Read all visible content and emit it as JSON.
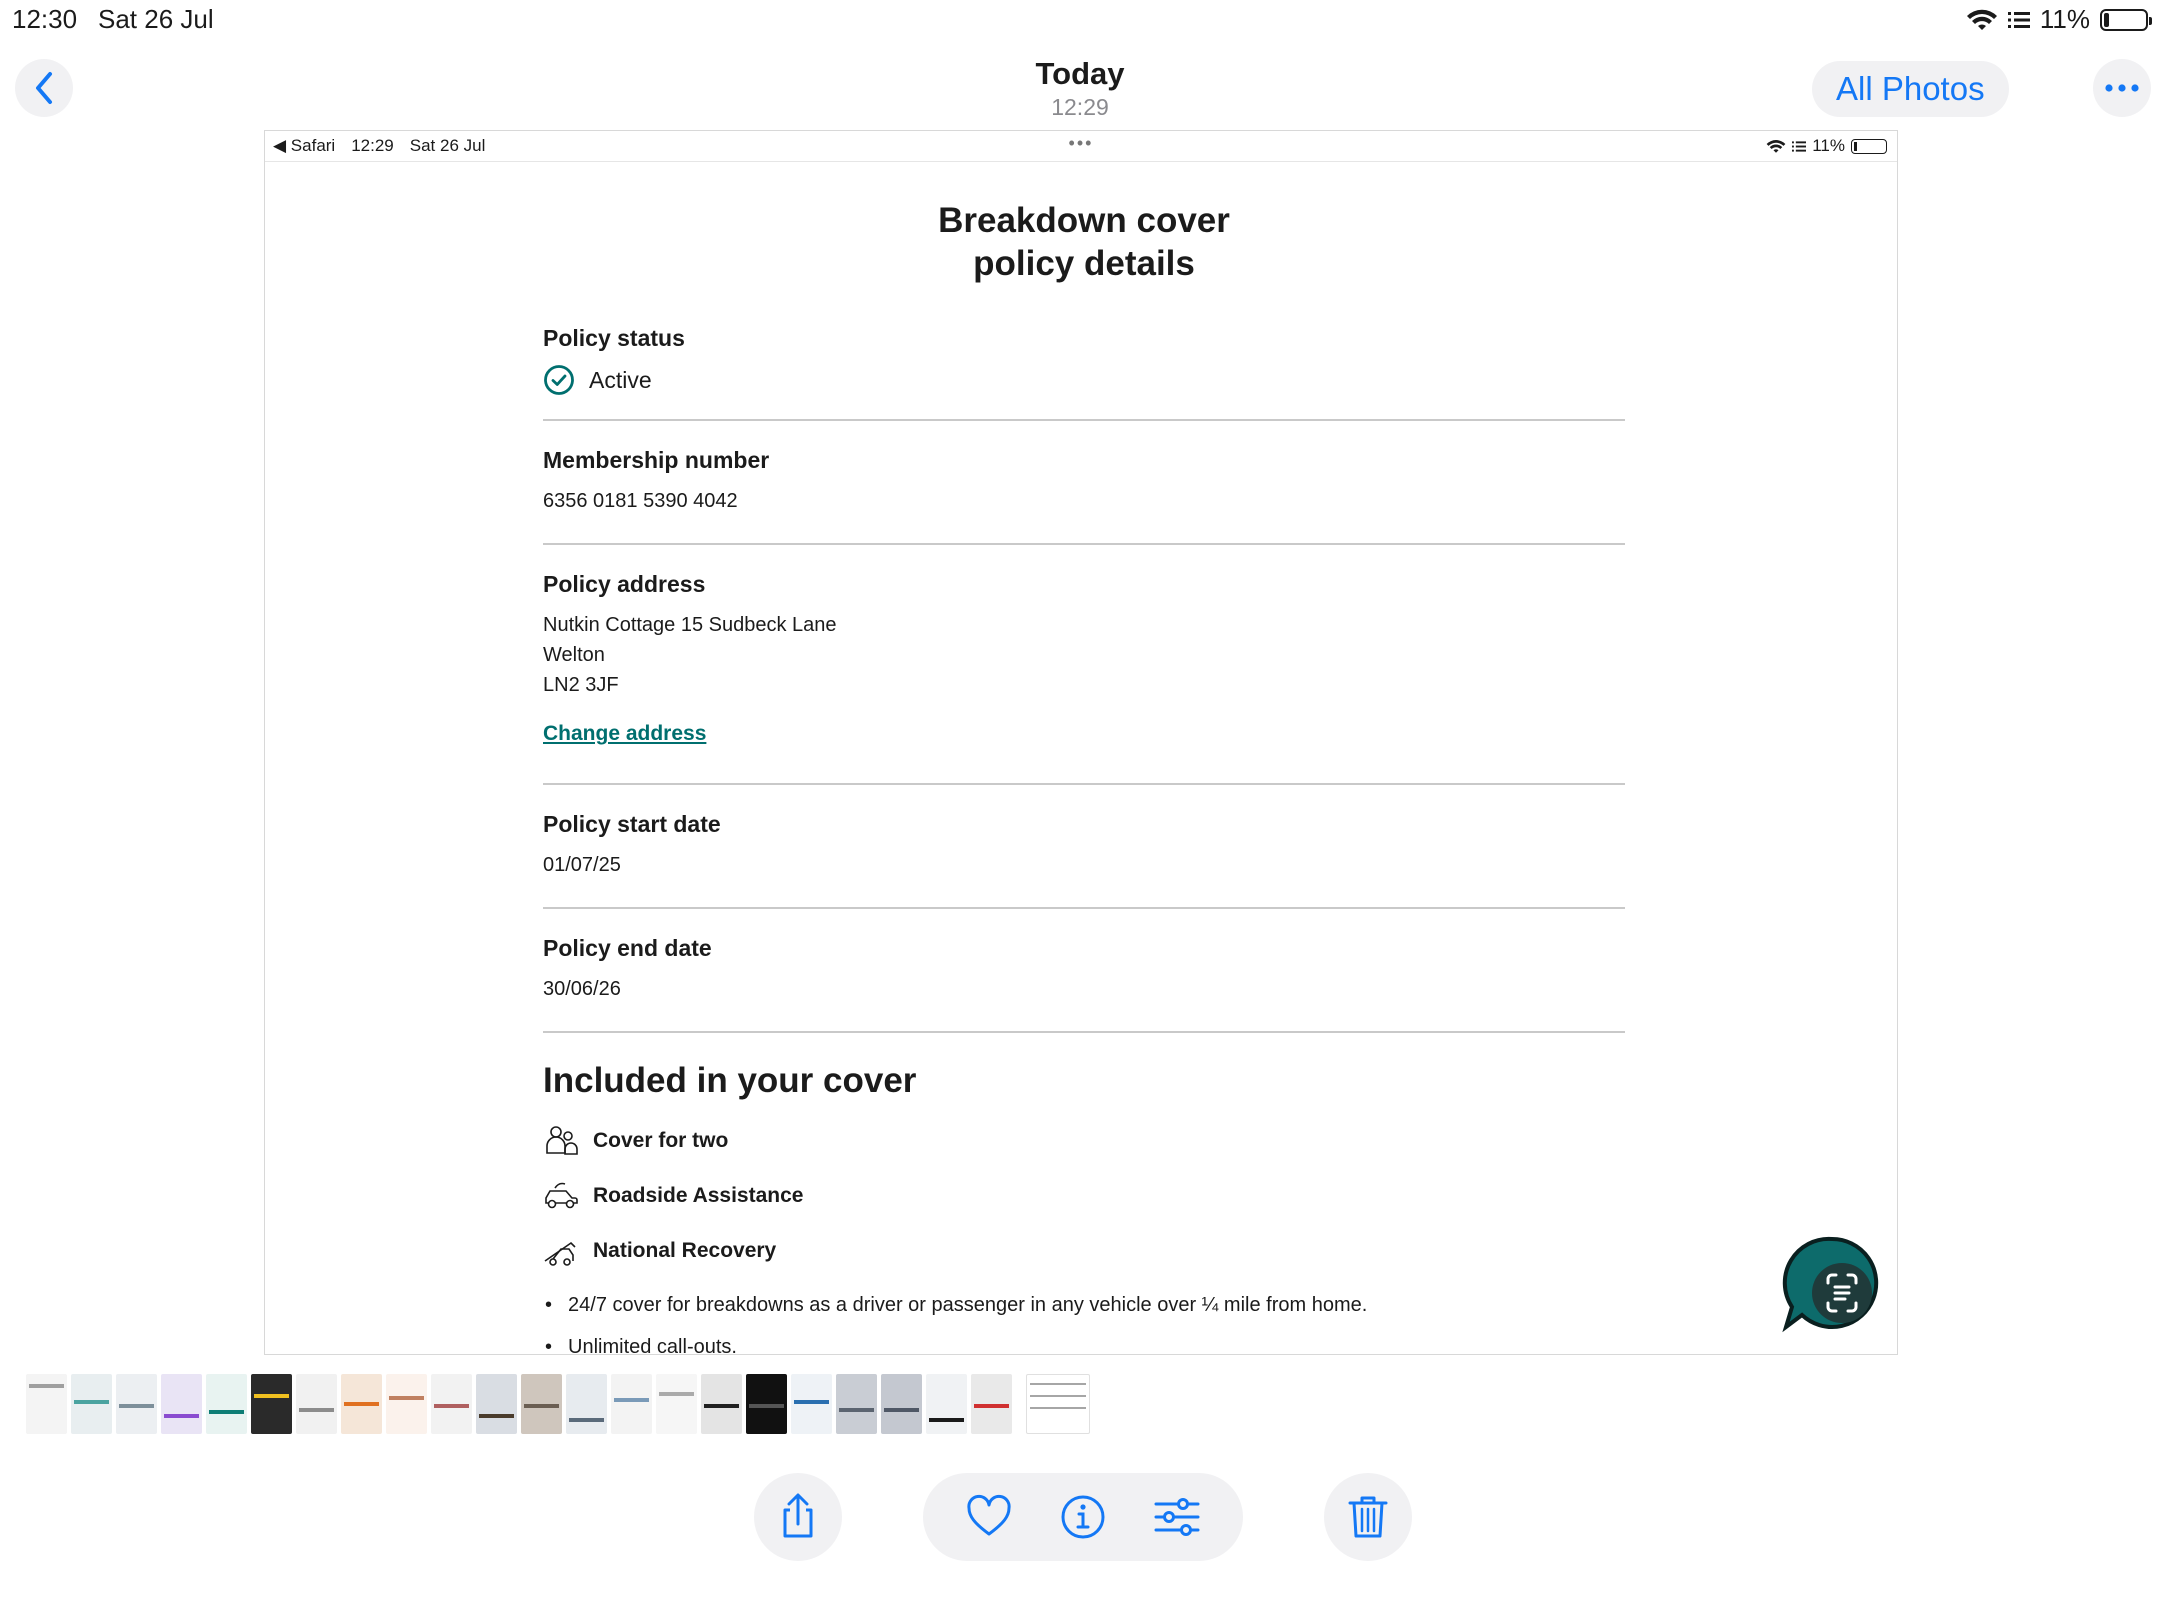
{
  "status_bar": {
    "time": "12:30",
    "date": "Sat 26 Jul",
    "battery": "11%",
    "battery_level": 0.11
  },
  "header": {
    "title": "Today",
    "subtitle": "12:29",
    "all_photos_label": "All Photos"
  },
  "embedded": {
    "status": {
      "back_label": "◀ Safari",
      "time": "12:29",
      "date": "Sat 26 Jul",
      "dots": "•••",
      "battery": "11%"
    },
    "page_title_line1": "Breakdown cover",
    "page_title_line2": "policy details",
    "policy_status": {
      "label": "Policy status",
      "value": "Active"
    },
    "membership": {
      "label": "Membership number",
      "value": "6356 0181 5390 4042"
    },
    "address": {
      "label": "Policy address",
      "line1": "Nutkin Cottage 15 Sudbeck Lane",
      "line2": "Welton",
      "line3": "LN2 3JF",
      "change_link": "Change address"
    },
    "start_date": {
      "label": "Policy start date",
      "value": "01/07/25"
    },
    "end_date": {
      "label": "Policy end date",
      "value": "30/06/26"
    },
    "cover": {
      "title": "Included in your cover",
      "items": [
        {
          "label": "Cover for two",
          "icon": "people-icon"
        },
        {
          "label": "Roadside Assistance",
          "icon": "car-icon"
        },
        {
          "label": "National Recovery",
          "icon": "recovery-truck-icon"
        }
      ],
      "bullets": [
        "24/7 cover for breakdowns as a driver or passenger in any vehicle over ¼ mile from home.",
        "Unlimited call-outs."
      ]
    },
    "accent_color": "#006f6f"
  },
  "toolbar": {
    "accent_color": "#1478f5"
  }
}
